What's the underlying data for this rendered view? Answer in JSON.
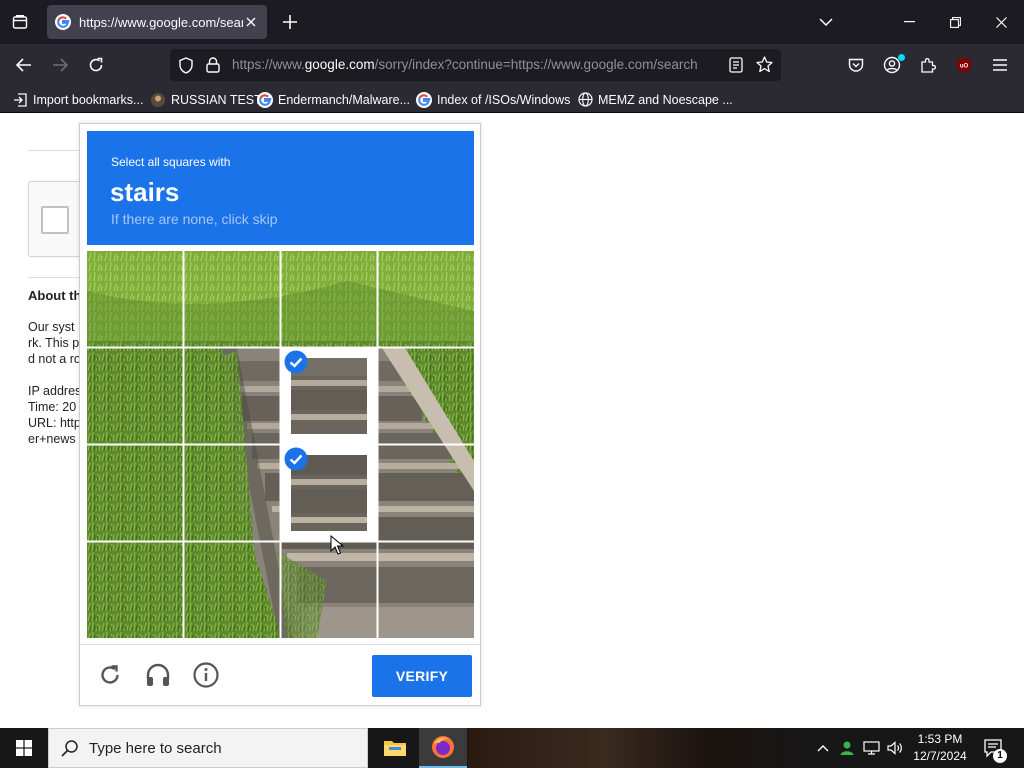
{
  "browser": {
    "tab": {
      "title": "https://www.google.com/search"
    },
    "url": {
      "prefix": "https://www.",
      "host": "google.com",
      "rest": "/sorry/index?continue=https://www.google.com/search"
    },
    "bookmarks": [
      {
        "label": "Import bookmarks...",
        "icon": "import-icon"
      },
      {
        "label": "RUSSIAN TEST",
        "icon": "page-favicon"
      },
      {
        "label": "Endermanch/Malware...",
        "icon": "google-favicon"
      },
      {
        "label": "Index of /ISOs/Windows",
        "icon": "google-favicon"
      },
      {
        "label": "MEMZ and Noescape ...",
        "icon": "globe-icon"
      }
    ]
  },
  "page": {
    "about_heading": "About th",
    "para_lines": [
      "Our syst",
      "rk. This p",
      "d not a ro"
    ],
    "meta_lines": [
      "IP addres",
      "Time: 20",
      "URL: http",
      "er+news"
    ]
  },
  "captcha": {
    "instruction": "Select all squares with",
    "target": "stairs",
    "hint": "If there are none, click skip",
    "verify_label": "VERIFY",
    "selected_tiles": [
      "row2-col3",
      "row3-col3"
    ],
    "accent": "#1a73e8"
  },
  "taskbar": {
    "search_placeholder": "Type here to search",
    "time": "1:53 PM",
    "date": "12/7/2024",
    "notification_count": "1"
  }
}
